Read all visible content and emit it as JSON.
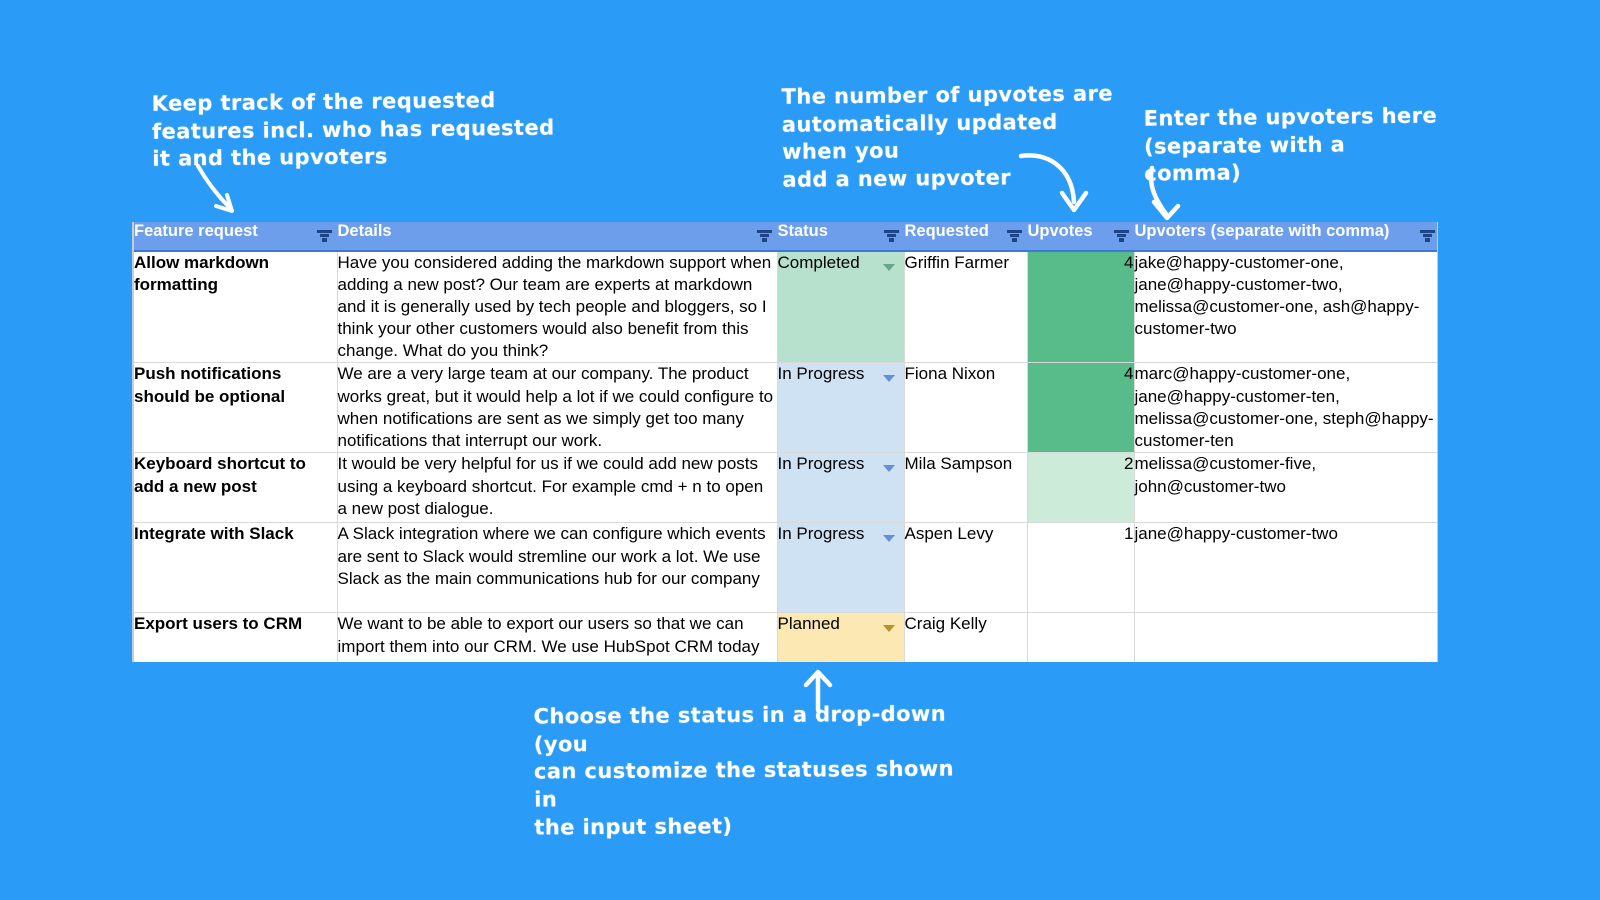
{
  "theme": {
    "background": "#2a9cf8",
    "header_bg": "#6d9eeb",
    "header_text": "#ffffff",
    "status_completed_bg": "#b7e1cd",
    "status_inprogress_bg": "#cfe2f3",
    "status_planned_bg": "#fce8b2",
    "upvotes_high_bg": "#57bb8a",
    "upvotes_low_bg": "#cdebd9"
  },
  "annotations": {
    "left": "Keep track of the requested\nfeatures incl. who has requested\nit and the upvoters",
    "middle": "The number of upvotes are\nautomatically updated when you\nadd a new upvoter",
    "right": "Enter the upvoters here\n(separate with a comma)",
    "bottom": "Choose the status in a drop-down (you\ncan customize the statuses shown in\nthe input sheet)"
  },
  "table": {
    "columns": [
      {
        "label": "Feature request",
        "filter_icon": "filter-icon"
      },
      {
        "label": "Details",
        "filter_icon": "filter-icon"
      },
      {
        "label": "Status",
        "filter_icon": "filter-icon"
      },
      {
        "label": "Requested",
        "filter_icon": "filter-icon"
      },
      {
        "label": "Upvotes",
        "filter_icon": "filter-icon"
      },
      {
        "label": "Upvoters (separate with comma)",
        "filter_icon": "filter-icon"
      }
    ],
    "rows": [
      {
        "feature": "Allow markdown formatting",
        "details": "Have you considered adding the markdown support when adding a new post? Our team are experts at markdown and it is generally used by tech people and bloggers, so I think your other customers would also benefit from this change. What do you think?",
        "status": "Completed",
        "requested": "Griffin Farmer",
        "upvotes": "4",
        "upvoters": "jake@happy-customer-one, jane@happy-customer-two, melissa@customer-one, ash@happy-customer-two"
      },
      {
        "feature": "Push notifications should be optional",
        "details": "We are a very large team at our company. The product works great, but it would help a lot if we could configure to when notifications are sent as we simply get too many notifications that interrupt our work.",
        "status": "In Progress",
        "requested": "Fiona Nixon",
        "upvotes": "4",
        "upvoters": "marc@happy-customer-one, jane@happy-customer-ten, melissa@customer-one, steph@happy-customer-ten"
      },
      {
        "feature": "Keyboard shortcut to add a new post",
        "details": "It would be very helpful for us if we could add new posts using a keyboard shortcut. For example cmd + n to open a new post dialogue.",
        "status": "In Progress",
        "requested": "Mila Sampson",
        "upvotes": "2",
        "upvoters": "melissa@customer-five, john@customer-two"
      },
      {
        "feature": "Integrate with Slack",
        "details": "A Slack integration where we can configure which events are sent to Slack would stremline our work a lot. We use Slack as the main communications hub for our company",
        "status": "In Progress",
        "requested": "Aspen Levy",
        "upvotes": "1",
        "upvoters": "jane@happy-customer-two"
      },
      {
        "feature": "Export users to CRM",
        "details": "We want to be able to export our users so that we can import them into our CRM. We use HubSpot CRM today",
        "status": "Planned",
        "requested": "Craig Kelly",
        "upvotes": "",
        "upvoters": ""
      }
    ]
  }
}
